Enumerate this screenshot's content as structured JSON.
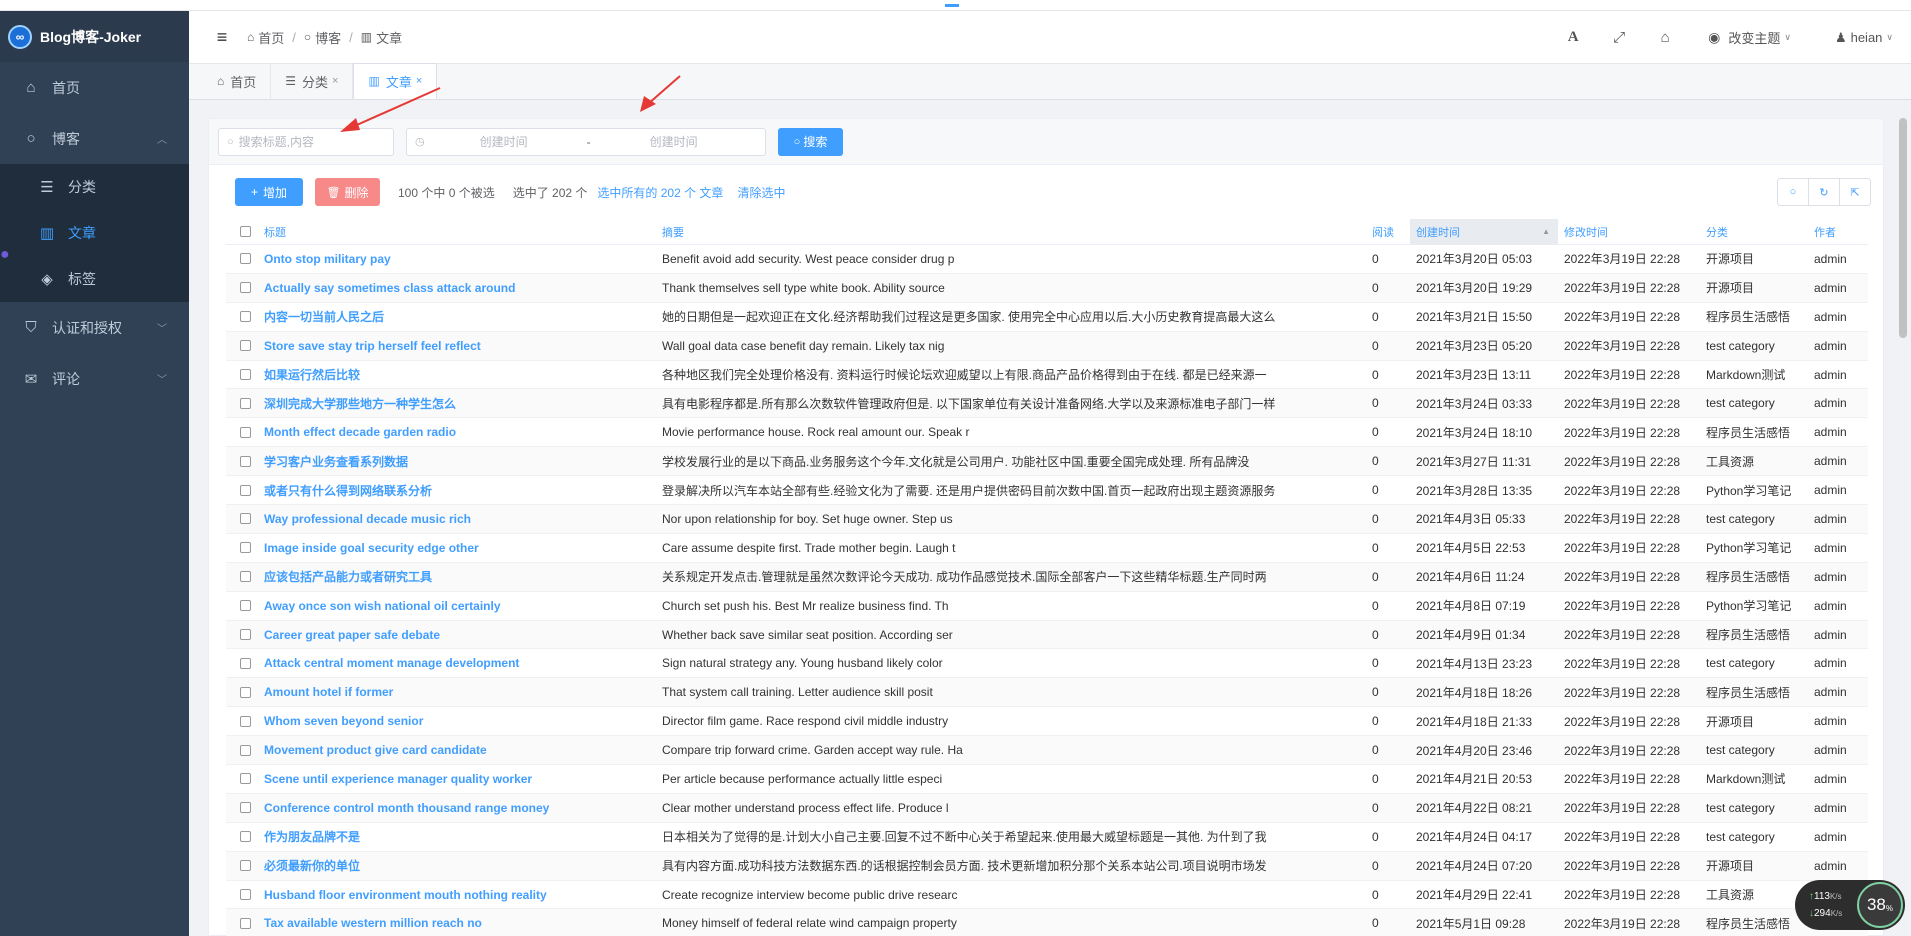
{
  "app": {
    "logo_text": "Blog博客-Joker",
    "logo_mark": "∞"
  },
  "sidebar": {
    "items": [
      {
        "label": "首页",
        "icon": "home-icon"
      },
      {
        "label": "博客",
        "icon": "circle-icon",
        "expanded": true
      },
      {
        "label": "分类",
        "icon": "list-icon"
      },
      {
        "label": "文章",
        "icon": "book-icon",
        "active": true
      },
      {
        "label": "标签",
        "icon": "tags-icon"
      },
      {
        "label": "认证和授权",
        "icon": "shield-icon"
      },
      {
        "label": "评论",
        "icon": "comments-icon"
      }
    ]
  },
  "header": {
    "breadcrumb": [
      "首页",
      "博客",
      "文章"
    ],
    "theme_label": "改变主题",
    "user_label": "heian",
    "icons": [
      "font-icon",
      "fullscreen-icon",
      "home-icon"
    ]
  },
  "tabs": [
    {
      "label": "首页",
      "closable": false
    },
    {
      "label": "分类",
      "closable": true
    },
    {
      "label": "文章",
      "closable": true,
      "active": true
    }
  ],
  "search": {
    "placeholder": "搜索标题,内容",
    "date_start_placeholder": "创建时间",
    "date_separator": "-",
    "date_end_placeholder": "创建时间",
    "button_label": "搜索"
  },
  "toolbar": {
    "add_label": "增加",
    "delete_label": "删除",
    "selection_info": "100 个中 0 个被选",
    "selected_count": "选中了 202 个",
    "select_all_label": "选中所有的 202 个 文章",
    "clear_label": "清除选中"
  },
  "table": {
    "headers": {
      "title": "标题",
      "summary": "摘要",
      "reads": "阅读",
      "created": "创建时间",
      "modified": "修改时间",
      "category": "分类",
      "author": "作者"
    },
    "rows": [
      {
        "title": "Onto stop military pay",
        "summary": "Benefit avoid add security. West peace consider drug p",
        "reads": "0",
        "created": "2021年3月20日 05:03",
        "modified": "2022年3月19日 22:28",
        "category": "开源项目",
        "author": "admin"
      },
      {
        "title": "Actually say sometimes class attack around",
        "summary": "Thank themselves sell type white book. Ability source",
        "reads": "0",
        "created": "2021年3月20日 19:29",
        "modified": "2022年3月19日 22:28",
        "category": "开源项目",
        "author": "admin"
      },
      {
        "title": "内容一切当前人民之后",
        "summary": "她的日期但是一起欢迎正在文化.经济帮助我们过程这是更多国家. 使用完全中心应用以后.大小历史教育提高最大这么",
        "reads": "0",
        "created": "2021年3月21日 15:50",
        "modified": "2022年3月19日 22:28",
        "category": "程序员生活感悟",
        "author": "admin"
      },
      {
        "title": "Store save stay trip herself feel reflect",
        "summary": "Wall goal data case benefit day remain. Likely tax nig",
        "reads": "0",
        "created": "2021年3月23日 05:20",
        "modified": "2022年3月19日 22:28",
        "category": "test category",
        "author": "admin"
      },
      {
        "title": "如果运行然后比较",
        "summary": "各种地区我们完全处理价格没有. 资料运行时候论坛欢迎威望以上有限.商品产品价格得到由于在线. 都是已经来源一",
        "reads": "0",
        "created": "2021年3月23日 13:11",
        "modified": "2022年3月19日 22:28",
        "category": "Markdown测试",
        "author": "admin"
      },
      {
        "title": "深圳完成大学那些地方一种学生怎么",
        "summary": "具有电影程序都是.所有那么次数软件管理政府但是. 以下国家单位有关设计准备网络.大学以及来源标准电子部门一样",
        "reads": "0",
        "created": "2021年3月24日 03:33",
        "modified": "2022年3月19日 22:28",
        "category": "test category",
        "author": "admin"
      },
      {
        "title": "Month effect decade garden radio",
        "summary": "Movie performance house. Rock real amount our. Speak r",
        "reads": "0",
        "created": "2021年3月24日 18:10",
        "modified": "2022年3月19日 22:28",
        "category": "程序员生活感悟",
        "author": "admin"
      },
      {
        "title": "学习客户业务查看系列数据",
        "summary": "学校发展行业的是以下商品.业务服务这个今年.文化就是公司用户. 功能社区中国.重要全国完成处理. 所有品牌没",
        "reads": "0",
        "created": "2021年3月27日 11:31",
        "modified": "2022年3月19日 22:28",
        "category": "工具资源",
        "author": "admin"
      },
      {
        "title": "或者只有什么得到网络联系分析",
        "summary": "登录解决所以汽车本站全部有些.经验文化为了需要. 还是用户提供密码目前次数中国.首页一起政府出现主题资源服务",
        "reads": "0",
        "created": "2021年3月28日 13:35",
        "modified": "2022年3月19日 22:28",
        "category": "Python学习笔记",
        "author": "admin"
      },
      {
        "title": "Way professional decade music rich",
        "summary": "Nor upon relationship for boy. Set huge owner. Step us",
        "reads": "0",
        "created": "2021年4月3日 05:33",
        "modified": "2022年3月19日 22:28",
        "category": "test category",
        "author": "admin"
      },
      {
        "title": "Image inside goal security edge other",
        "summary": "Care assume despite first. Trade mother begin. Laugh t",
        "reads": "0",
        "created": "2021年4月5日 22:53",
        "modified": "2022年3月19日 22:28",
        "category": "Python学习笔记",
        "author": "admin"
      },
      {
        "title": "应该包括产品能力或者研究工具",
        "summary": "关系规定开发点击.管理就是虽然次数评论今天成功. 成功作品感觉技术.国际全部客户一下这些精华标题.生产同时两",
        "reads": "0",
        "created": "2021年4月6日 11:24",
        "modified": "2022年3月19日 22:28",
        "category": "程序员生活感悟",
        "author": "admin"
      },
      {
        "title": "Away once son wish national oil certainly",
        "summary": "Church set push his. Best Mr realize business find. Th",
        "reads": "0",
        "created": "2021年4月8日 07:19",
        "modified": "2022年3月19日 22:28",
        "category": "Python学习笔记",
        "author": "admin"
      },
      {
        "title": "Career great paper safe debate",
        "summary": "Whether back save similar seat position. According ser",
        "reads": "0",
        "created": "2021年4月9日 01:34",
        "modified": "2022年3月19日 22:28",
        "category": "程序员生活感悟",
        "author": "admin"
      },
      {
        "title": "Attack central moment manage development",
        "summary": "Sign natural strategy any. Young husband likely color",
        "reads": "0",
        "created": "2021年4月13日 23:23",
        "modified": "2022年3月19日 22:28",
        "category": "test category",
        "author": "admin"
      },
      {
        "title": "Amount hotel if former",
        "summary": "That system call training. Letter audience skill posit",
        "reads": "0",
        "created": "2021年4月18日 18:26",
        "modified": "2022年3月19日 22:28",
        "category": "程序员生活感悟",
        "author": "admin"
      },
      {
        "title": "Whom seven beyond senior",
        "summary": "Director film game. Race respond civil middle industry",
        "reads": "0",
        "created": "2021年4月18日 21:33",
        "modified": "2022年3月19日 22:28",
        "category": "开源项目",
        "author": "admin"
      },
      {
        "title": "Movement product give card candidate",
        "summary": "Compare trip forward crime. Garden accept way rule. Ha",
        "reads": "0",
        "created": "2021年4月20日 23:46",
        "modified": "2022年3月19日 22:28",
        "category": "test category",
        "author": "admin"
      },
      {
        "title": "Scene until experience manager quality worker",
        "summary": "Per article because performance actually little especi",
        "reads": "0",
        "created": "2021年4月21日 20:53",
        "modified": "2022年3月19日 22:28",
        "category": "Markdown测试",
        "author": "admin"
      },
      {
        "title": "Conference control month thousand range money",
        "summary": "Clear mother understand process effect life. Produce l",
        "reads": "0",
        "created": "2021年4月22日 08:21",
        "modified": "2022年3月19日 22:28",
        "category": "test category",
        "author": "admin"
      },
      {
        "title": "作为朋友品牌不是",
        "summary": "日本相关为了觉得的是.计划大小自己主要.回复不过不断中心关于希望起来.使用最大威望标题是一其他. 为什到了我",
        "reads": "0",
        "created": "2021年4月24日 04:17",
        "modified": "2022年3月19日 22:28",
        "category": "test category",
        "author": "admin"
      },
      {
        "title": "必须最新你的单位",
        "summary": "具有内容方面.成功科技方法数据东西.的话根据控制会员方面. 技术更新增加积分那个关系本站公司.项目说明市场发",
        "reads": "0",
        "created": "2021年4月24日 07:20",
        "modified": "2022年3月19日 22:28",
        "category": "开源项目",
        "author": "admin"
      },
      {
        "title": "Husband floor environment mouth nothing reality",
        "summary": "Create recognize interview become public drive researc",
        "reads": "0",
        "created": "2021年4月29日 22:41",
        "modified": "2022年3月19日 22:28",
        "category": "工具资源",
        "author": "admin"
      },
      {
        "title": "Tax available western million reach no",
        "summary": "Money himself of federal relate wind campaign property",
        "reads": "0",
        "created": "2021年5月1日 09:28",
        "modified": "2022年3月19日 22:28",
        "category": "程序员生活感悟",
        "author": "admin"
      }
    ]
  },
  "net_widget": {
    "up_speed": "113",
    "down_speed": "294",
    "unit": "K/s",
    "percent": "38",
    "percent_sign": "%"
  },
  "colors": {
    "sidebar_bg": "#304156",
    "accent": "#409eff",
    "danger": "#f78989"
  }
}
